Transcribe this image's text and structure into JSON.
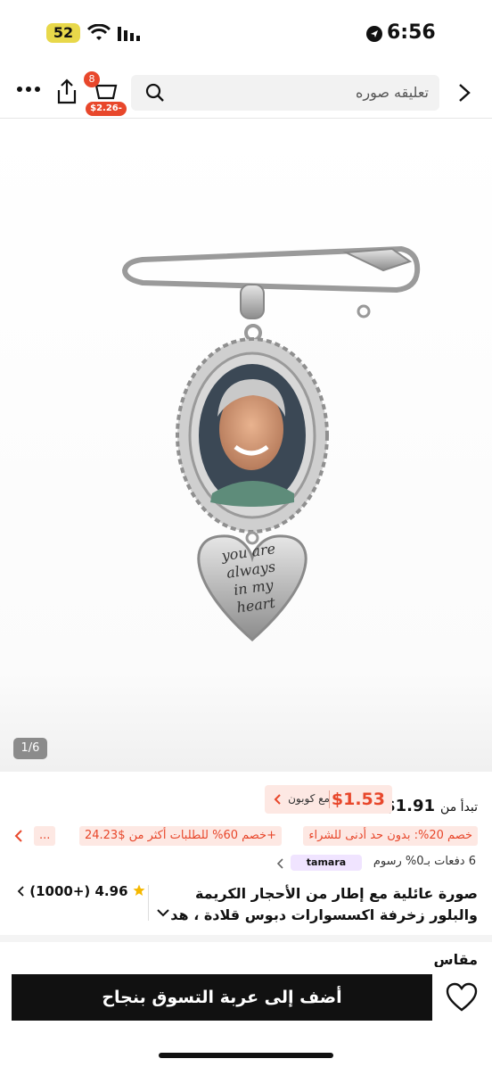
{
  "status_bar": {
    "battery": "52",
    "time": "6:56"
  },
  "header": {
    "search_placeholder": "تعليقه صوره",
    "cart_count": "8",
    "cart_price_badge": "$2.26-"
  },
  "gallery": {
    "engraving": [
      "you are",
      "always",
      "in my",
      "heart"
    ],
    "pager": "1/6"
  },
  "price": {
    "from_label": "تبدأ من",
    "from_price": "$1.91",
    "coupon_price": "$1.53",
    "coupon_label": "مع كوبون"
  },
  "promos": [
    "خصم 20%: بدون حد أدنى للشراء",
    "خصم 60% للطلبات أكثر من $24.23+",
    "..."
  ],
  "installments": {
    "text": "6 دفعات بـ0% رسوم",
    "provider": "tamara"
  },
  "product": {
    "title_line1": "صورة عائلية مع إطار من الأحجار الكريمة",
    "title_line2": "والبلور زخرفة اكسسوارات دبوس قلادة ، هد",
    "rating": "4.96",
    "reviews": "(1000+)"
  },
  "size_label": "مقاس",
  "add_to_cart": "أضف إلى عربة التسوق بنجاح",
  "colors": {
    "accent": "#e8472b",
    "coupon_bg": "#fde8e3",
    "button": "#111111"
  }
}
